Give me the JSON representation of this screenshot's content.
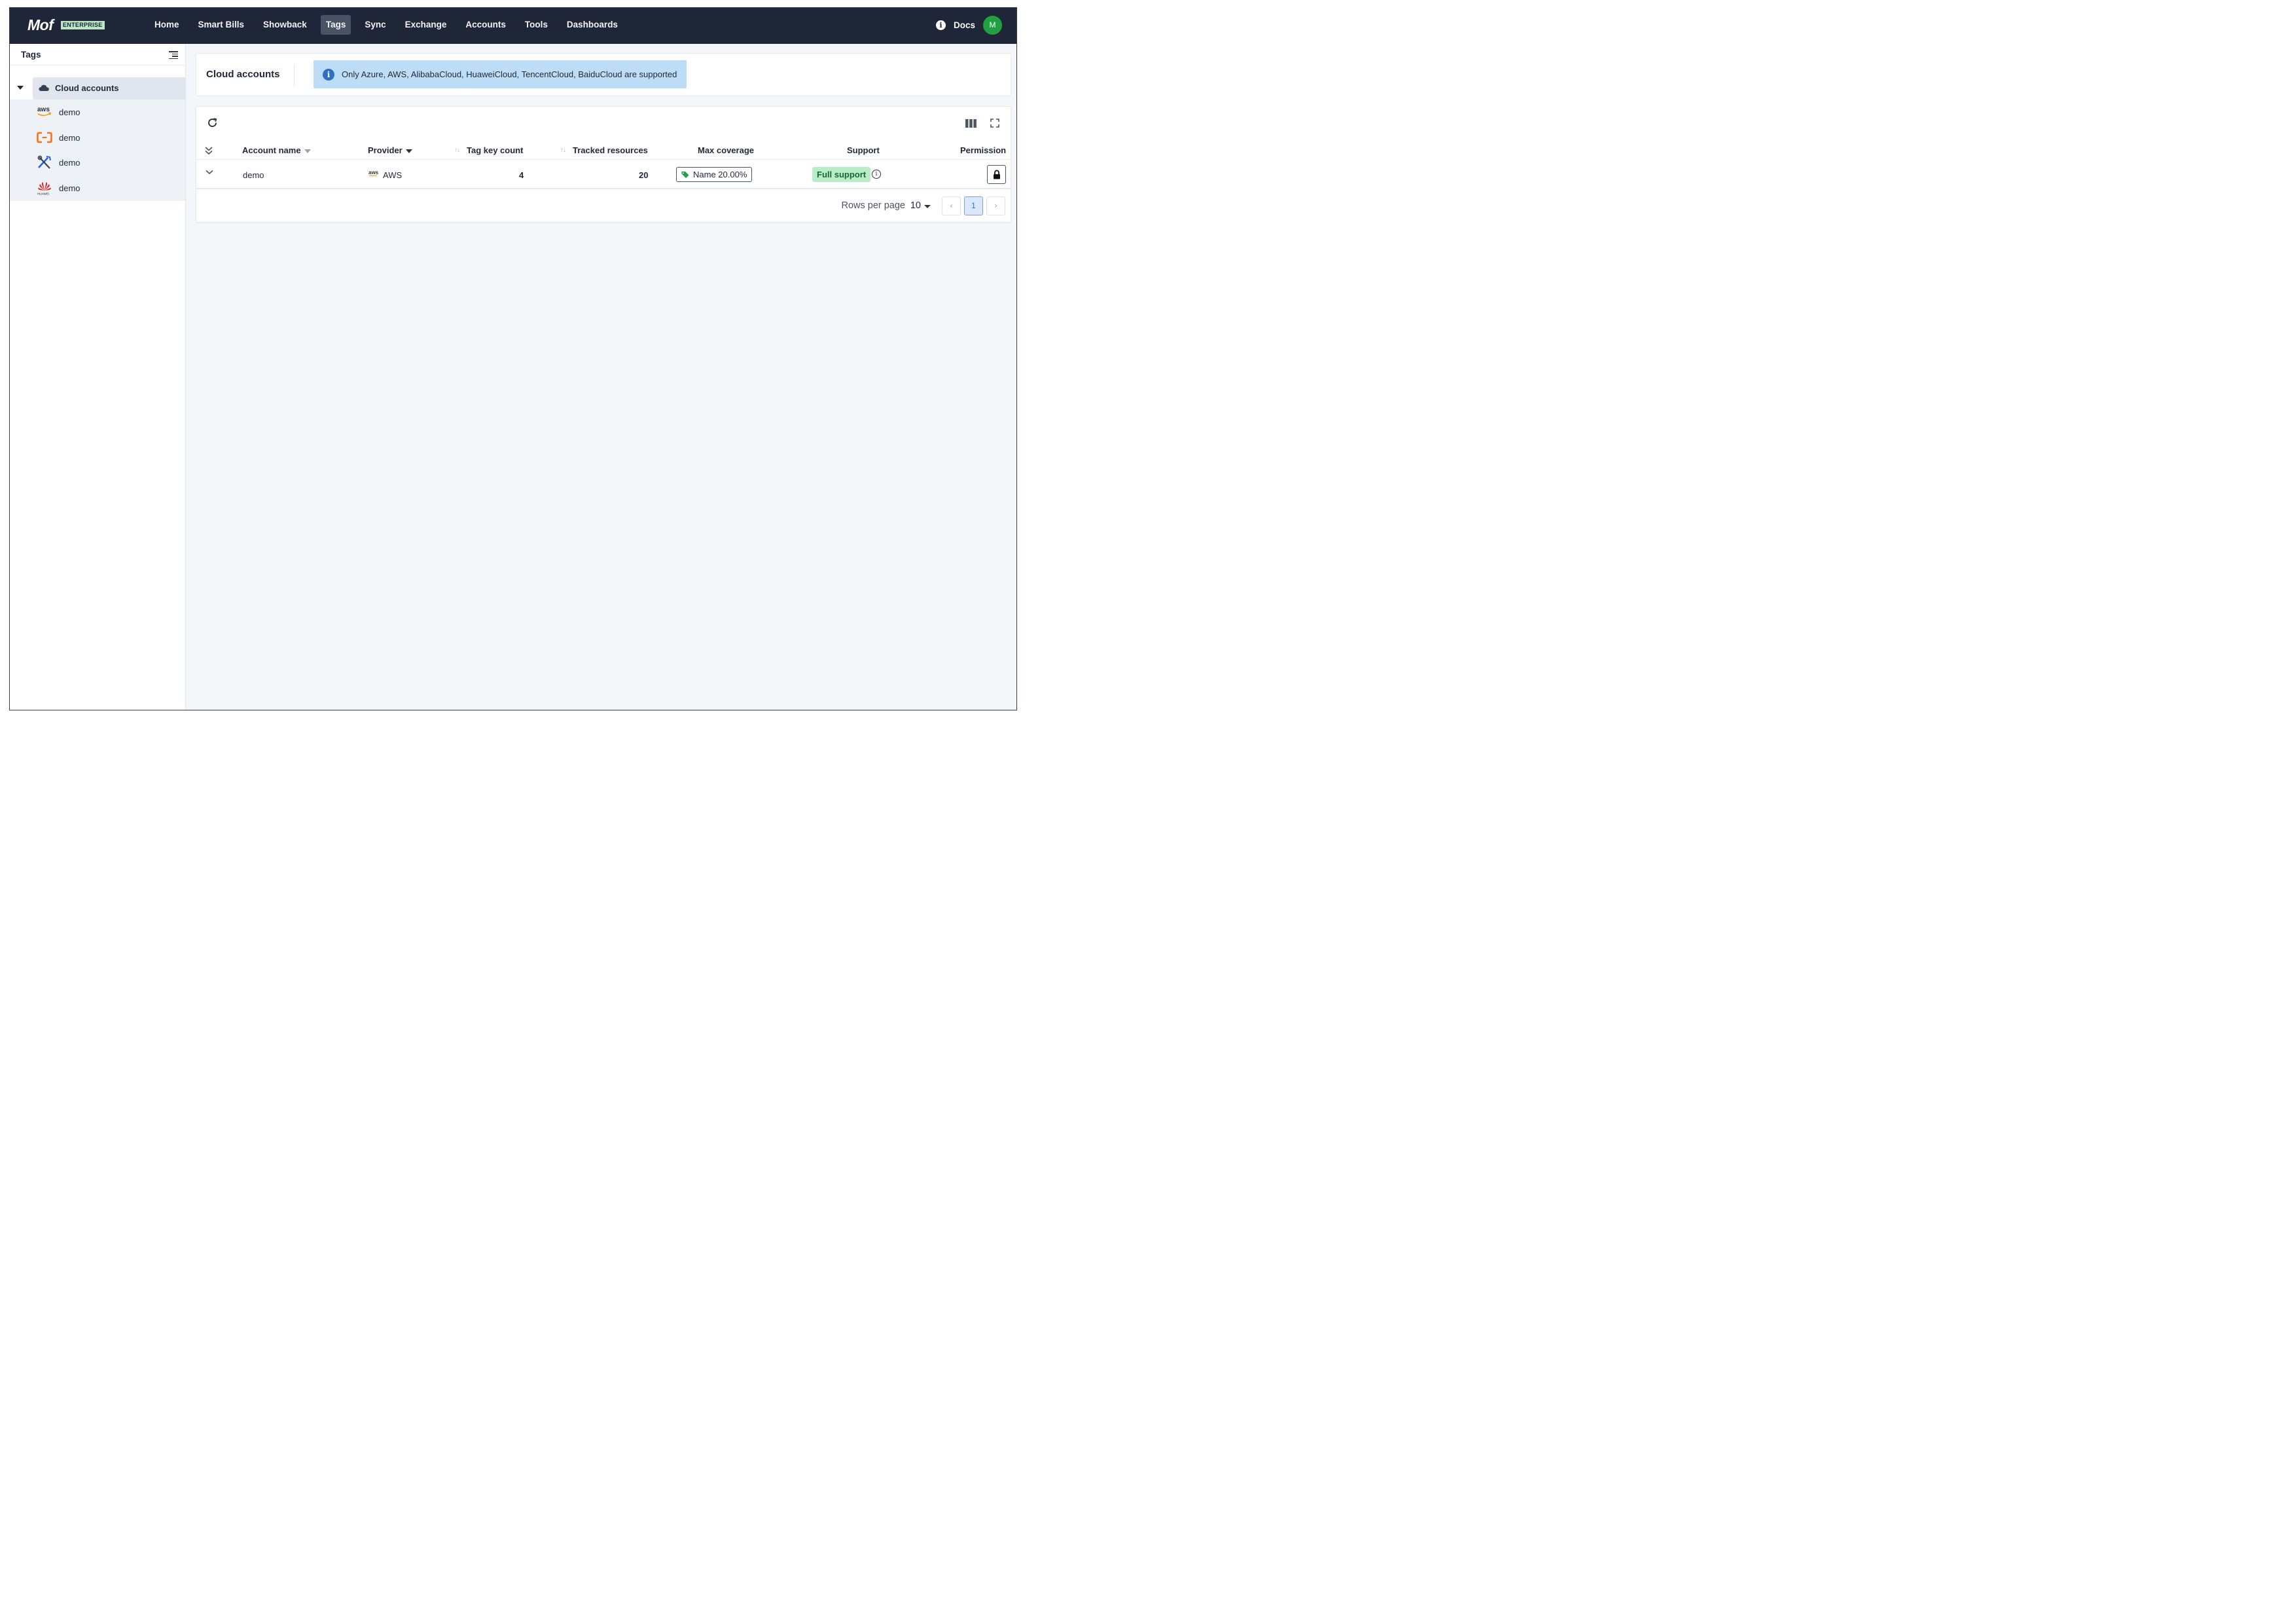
{
  "app": {
    "logo": "Mof",
    "edition_badge": "ENTERPRISE"
  },
  "nav": [
    {
      "label": "Home"
    },
    {
      "label": "Smart Bills"
    },
    {
      "label": "Showback"
    },
    {
      "label": "Tags",
      "active": true
    },
    {
      "label": "Sync"
    },
    {
      "label": "Exchange"
    },
    {
      "label": "Accounts"
    },
    {
      "label": "Tools"
    },
    {
      "label": "Dashboards"
    }
  ],
  "topbar": {
    "docs_label": "Docs",
    "avatar_initial": "M",
    "info_icon": "info-icon"
  },
  "sidebar": {
    "title": "Tags",
    "root": {
      "label": "Cloud accounts",
      "icon": "cloud-icon"
    },
    "children": [
      {
        "label": "demo",
        "icon": "aws-logo-icon"
      },
      {
        "label": "demo",
        "icon": "alibaba-cloud-logo-icon"
      },
      {
        "label": "demo",
        "icon": "tools-logo-icon"
      },
      {
        "label": "demo",
        "icon": "huawei-logo-icon"
      }
    ]
  },
  "header": {
    "title": "Cloud accounts",
    "alert": "Only Azure, AWS, AlibabaCloud, HuaweiCloud, TencentCloud, BaiduCloud are supported"
  },
  "table": {
    "columns": {
      "account_name": "Account name",
      "provider": "Provider",
      "tag_key_count": "Tag key count",
      "tracked_resources": "Tracked resources",
      "max_coverage": "Max coverage",
      "support": "Support",
      "permission": "Permission"
    },
    "rows": [
      {
        "account_name": "demo",
        "provider": "AWS",
        "provider_logo_text": "aws",
        "tag_key_count": "4",
        "tracked_resources": "20",
        "max_coverage": "Name 20.00%",
        "support": "Full support"
      }
    ]
  },
  "pagination": {
    "rows_per_page_label": "Rows per page",
    "rows_per_page_value": "10",
    "current_page": "1"
  },
  "colors": {
    "topbar_bg": "#1f2637",
    "alert_bg": "#bdddf6",
    "support_bg": "#b9ecc9",
    "avatar_bg": "#21a040"
  }
}
